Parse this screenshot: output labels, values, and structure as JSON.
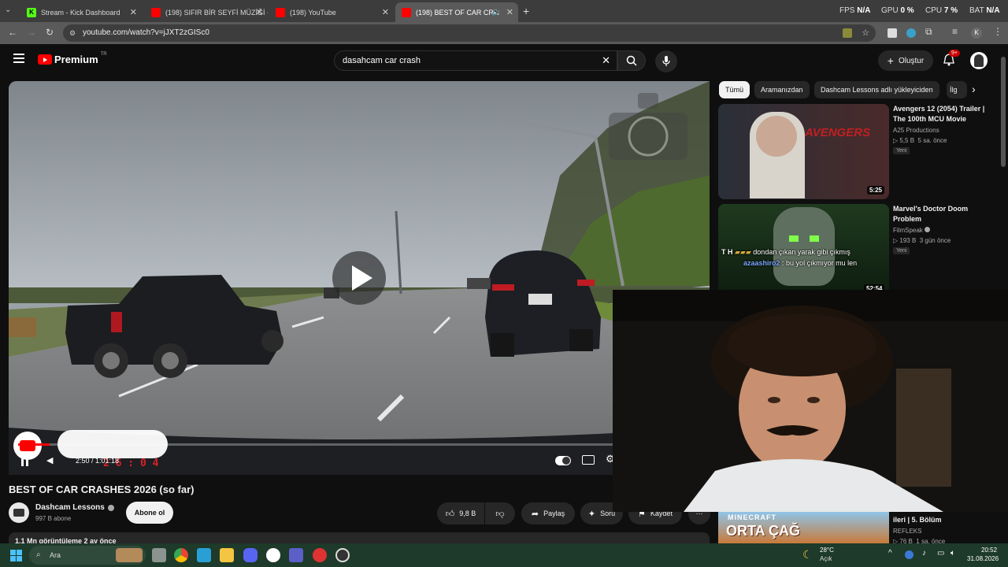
{
  "browser": {
    "tabs": [
      {
        "title": "Stream - Kick Dashboard",
        "active": false
      },
      {
        "title": "(198) SIFIR BİR SEYFİ MÜZİĞİ -",
        "active": false
      },
      {
        "title": "(198) YouTube",
        "active": false
      },
      {
        "title": "(198) BEST OF CAR CRASHI",
        "active": true
      }
    ],
    "new_tab": "+",
    "close": "✕",
    "url": "youtube.com/watch?v=jJXT2zGISc0",
    "overlay_stats": {
      "fps_label": "FPS",
      "fps_value": "N/A",
      "gpu_label": "GPU",
      "gpu_value": "0 %",
      "cpu_label": "CPU",
      "cpu_value": "7 %",
      "bat_label": "BAT",
      "bat_value": "N/A"
    },
    "profile_initial": "K"
  },
  "youtube": {
    "logo_text": "Premium",
    "logo_region": "TR",
    "search_value": "dasahcam car crash",
    "create_label": "Oluştur",
    "notif_badge": "9+"
  },
  "video": {
    "title": "BEST OF CAR CRASHES 2026 (so far)",
    "time": "2:50 / 1:01:18",
    "dashcam_timestamp": "2 6 : 0 4",
    "channel_name": "Dashcam Lessons",
    "subscribers": "997 B abone",
    "subscribe_label": "Abone ol",
    "likes": "9,8 B",
    "share_label": "Paylaş",
    "ask_label": "Soru",
    "save_label": "Kaydet",
    "views_partial": "1,1 Mn görüntüleme  2 ay önce",
    "progress": 0.046
  },
  "chips": [
    {
      "label": "Tümü",
      "selected": true
    },
    {
      "label": "Aramanızdan",
      "selected": false
    },
    {
      "label": "Dashcam Lessons adlı yükleyiciden",
      "selected": false
    },
    {
      "label": "İlg",
      "selected": false
    }
  ],
  "recommendations": [
    {
      "title": "Avengers 12 (2054) Trailer | The 100th MCU Movie",
      "channel": "A25 Productions",
      "views": "5,5 B",
      "age": "5 sa. önce",
      "badge": "Yeni",
      "duration": "5:25",
      "thumb_text": "AVENGERS"
    },
    {
      "title": "Marvel's Doctor Doom Problem",
      "channel": "FilmSpeak",
      "views": "193 B",
      "age": "3 gün önce",
      "badge": "Yeni",
      "duration": "52:54"
    },
    {
      "title": "ileri | 5. Bölüm",
      "channel": "REFLEKS",
      "views": "76 B",
      "age": "1 sa. önce",
      "thumb_text": "MINECRAFT",
      "thumb_text2": "ORTA ÇAĞ"
    }
  ],
  "chat_overlay": [
    {
      "user": "T H",
      "message": "dondan çıkan yarak gibi çıkmış"
    },
    {
      "user": "azaashiro2",
      "message": ": bu yol çıkmıyor mu len"
    }
  ],
  "taskbar": {
    "search_placeholder": "Ara",
    "weather_temp": "28°C",
    "weather_desc": "Açık",
    "time": "20:52",
    "date": "31.08.2026"
  },
  "colors": {
    "yt_red": "#ff0000",
    "tab_bg": "#3c3c3c",
    "taskbar_bg": "#1e3a2a"
  }
}
